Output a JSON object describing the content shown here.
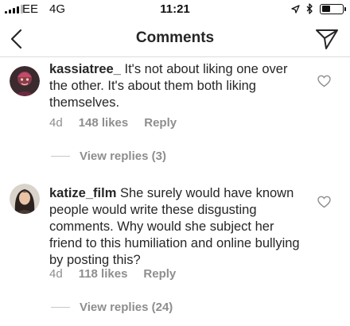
{
  "status_bar": {
    "carrier": "EE",
    "network": "4G",
    "time": "11:21",
    "battery_level": 0.4
  },
  "nav": {
    "title": "Comments",
    "back_icon": "chevron-left-icon",
    "send_icon": "paper-plane-icon"
  },
  "comments": [
    {
      "username": "kassiatree_",
      "text": "It's not about liking one over the other. It's about them both liking themselves.",
      "age": "4d",
      "likes": "148 likes",
      "reply_label": "Reply",
      "view_replies": "View replies (3)"
    },
    {
      "username": "katize_film",
      "text": "She surely would have known people would write these disgusting comments. Why would she subject her friend to this humiliation and online bullying by posting this?",
      "age": "4d",
      "likes": "118 likes",
      "reply_label": "Reply",
      "view_replies": "View replies (24)"
    }
  ],
  "colors": {
    "text": "#262626",
    "secondary": "#8e8e8e",
    "divider": "#dbdbdb"
  }
}
